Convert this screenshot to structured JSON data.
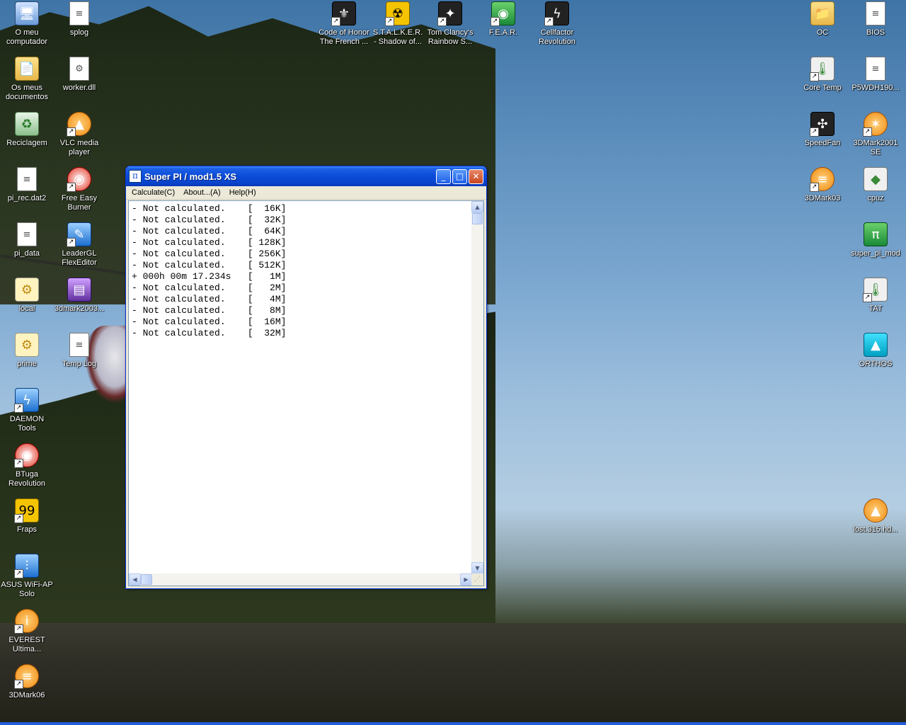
{
  "desktop": {
    "icons": [
      {
        "label": "O meu\ncomputador",
        "icon": "computer-icon",
        "glyph": "🖥"
      },
      {
        "label": "splog",
        "icon": "text-document-icon",
        "glyph": "≡"
      },
      {
        "label": "Os meus\ndocumentos",
        "icon": "folder-icon",
        "glyph": "📄"
      },
      {
        "label": "worker.dll",
        "icon": "dll-file-icon",
        "glyph": "⚙"
      },
      {
        "label": "Reciclagem",
        "icon": "recycle-bin-icon",
        "glyph": "♻"
      },
      {
        "label": "VLC media\nplayer",
        "icon": "vlc-cone-icon",
        "glyph": "▲"
      },
      {
        "label": "pi_rec.dat2",
        "icon": "data-file-icon",
        "glyph": "≡"
      },
      {
        "label": "Free Easy\nBurner",
        "icon": "cd-burner-icon",
        "glyph": "◎"
      },
      {
        "label": "pi_data",
        "icon": "text-document-icon",
        "glyph": "≡"
      },
      {
        "label": "LeaderGL\nFlexEditor",
        "icon": "editor-icon",
        "glyph": "✎"
      },
      {
        "label": "local",
        "icon": "config-file-icon",
        "glyph": "⚙"
      },
      {
        "label": "3dmark2003...",
        "icon": "winrar-archive-icon",
        "glyph": "▤"
      },
      {
        "label": "prime",
        "icon": "config-file-icon",
        "glyph": "⚙"
      },
      {
        "label": "Temp Log",
        "icon": "text-document-icon",
        "glyph": "≡"
      },
      {
        "label": "DAEMON Tools",
        "icon": "daemon-tools-icon",
        "glyph": "ϟ"
      },
      {
        "label": "BTuga\nRevolution",
        "icon": "btuga-icon",
        "glyph": "◉"
      },
      {
        "label": "Fraps",
        "icon": "fraps-icon",
        "glyph": "99"
      },
      {
        "label": "ASUS WiFi-AP\nSolo",
        "icon": "wifi-icon",
        "glyph": "⫶"
      },
      {
        "label": "EVEREST\nUltima...",
        "icon": "info-icon",
        "glyph": "i"
      },
      {
        "label": "3DMark06",
        "icon": "3dmark-icon",
        "glyph": "≡"
      },
      {
        "label": "Code of Honor\nThe French ...",
        "icon": "game-icon",
        "glyph": "⚜"
      },
      {
        "label": "S.T.A.L.K.E.R.\n- Shadow of...",
        "icon": "radiation-icon",
        "glyph": "☢"
      },
      {
        "label": "Tom Clancy's\nRainbow S...",
        "icon": "game-icon",
        "glyph": "✦"
      },
      {
        "label": "F.E.A.R.",
        "icon": "eye-icon",
        "glyph": "◉"
      },
      {
        "label": "Cellfactor\nRevolution",
        "icon": "game-icon",
        "glyph": "ϟ"
      },
      {
        "label": "OC",
        "icon": "folder-icon",
        "glyph": "📁"
      },
      {
        "label": "BIOS",
        "icon": "data-file-icon",
        "glyph": "≡"
      },
      {
        "label": "Core Temp",
        "icon": "thermometer-icon",
        "glyph": "🌡"
      },
      {
        "label": "P5WDH190...",
        "icon": "data-file-icon",
        "glyph": "≡"
      },
      {
        "label": "SpeedFan",
        "icon": "fan-icon",
        "glyph": "✣"
      },
      {
        "label": "3DMark2001\nSE",
        "icon": "3dmark-icon",
        "glyph": "✶"
      },
      {
        "label": "3DMark03",
        "icon": "3dmark-icon",
        "glyph": "≡"
      },
      {
        "label": "cpuz",
        "icon": "chip-icon",
        "glyph": "◆"
      },
      {
        "label": "super_pi_mod",
        "icon": "pi-icon",
        "glyph": "π"
      },
      {
        "label": "TAT",
        "icon": "thermometer-icon",
        "glyph": "🌡"
      },
      {
        "label": "ORTHOS",
        "icon": "orthos-icon",
        "glyph": "▲"
      },
      {
        "label": "lost.315.hd...",
        "icon": "vlc-cone-icon",
        "glyph": "▲"
      }
    ]
  },
  "window": {
    "title": "Super PI / mod1.5 XS",
    "title_icon_glyph": "π",
    "buttons": {
      "minimize": "_",
      "maximize": "□",
      "close": "✕"
    },
    "menu": [
      "Calculate(C)",
      "About...(A)",
      "Help(H)"
    ],
    "results": [
      "- Not calculated.    [  16K]",
      "- Not calculated.    [  32K]",
      "- Not calculated.    [  64K]",
      "- Not calculated.    [ 128K]",
      "- Not calculated.    [ 256K]",
      "- Not calculated.    [ 512K]",
      "+ 000h 00m 17.234s   [   1M]",
      "- Not calculated.    [   2M]",
      "- Not calculated.    [   4M]",
      "- Not calculated.    [   8M]",
      "- Not calculated.    [  16M]",
      "- Not calculated.    [  32M]"
    ],
    "scroll": {
      "up": "▲",
      "down": "▼",
      "left": "◀",
      "right": "▶",
      "grip": "⋰"
    }
  }
}
